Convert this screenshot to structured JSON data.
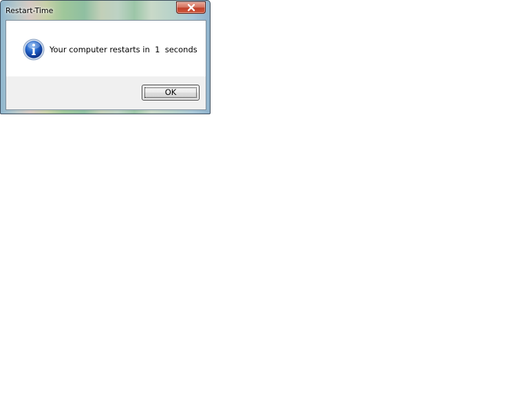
{
  "window": {
    "title": "Restart-Time",
    "close_icon": "close-icon"
  },
  "message": {
    "icon": "info-icon",
    "text": "Your computer restarts in  1  seconds"
  },
  "buttons": {
    "ok_label": "OK"
  }
}
